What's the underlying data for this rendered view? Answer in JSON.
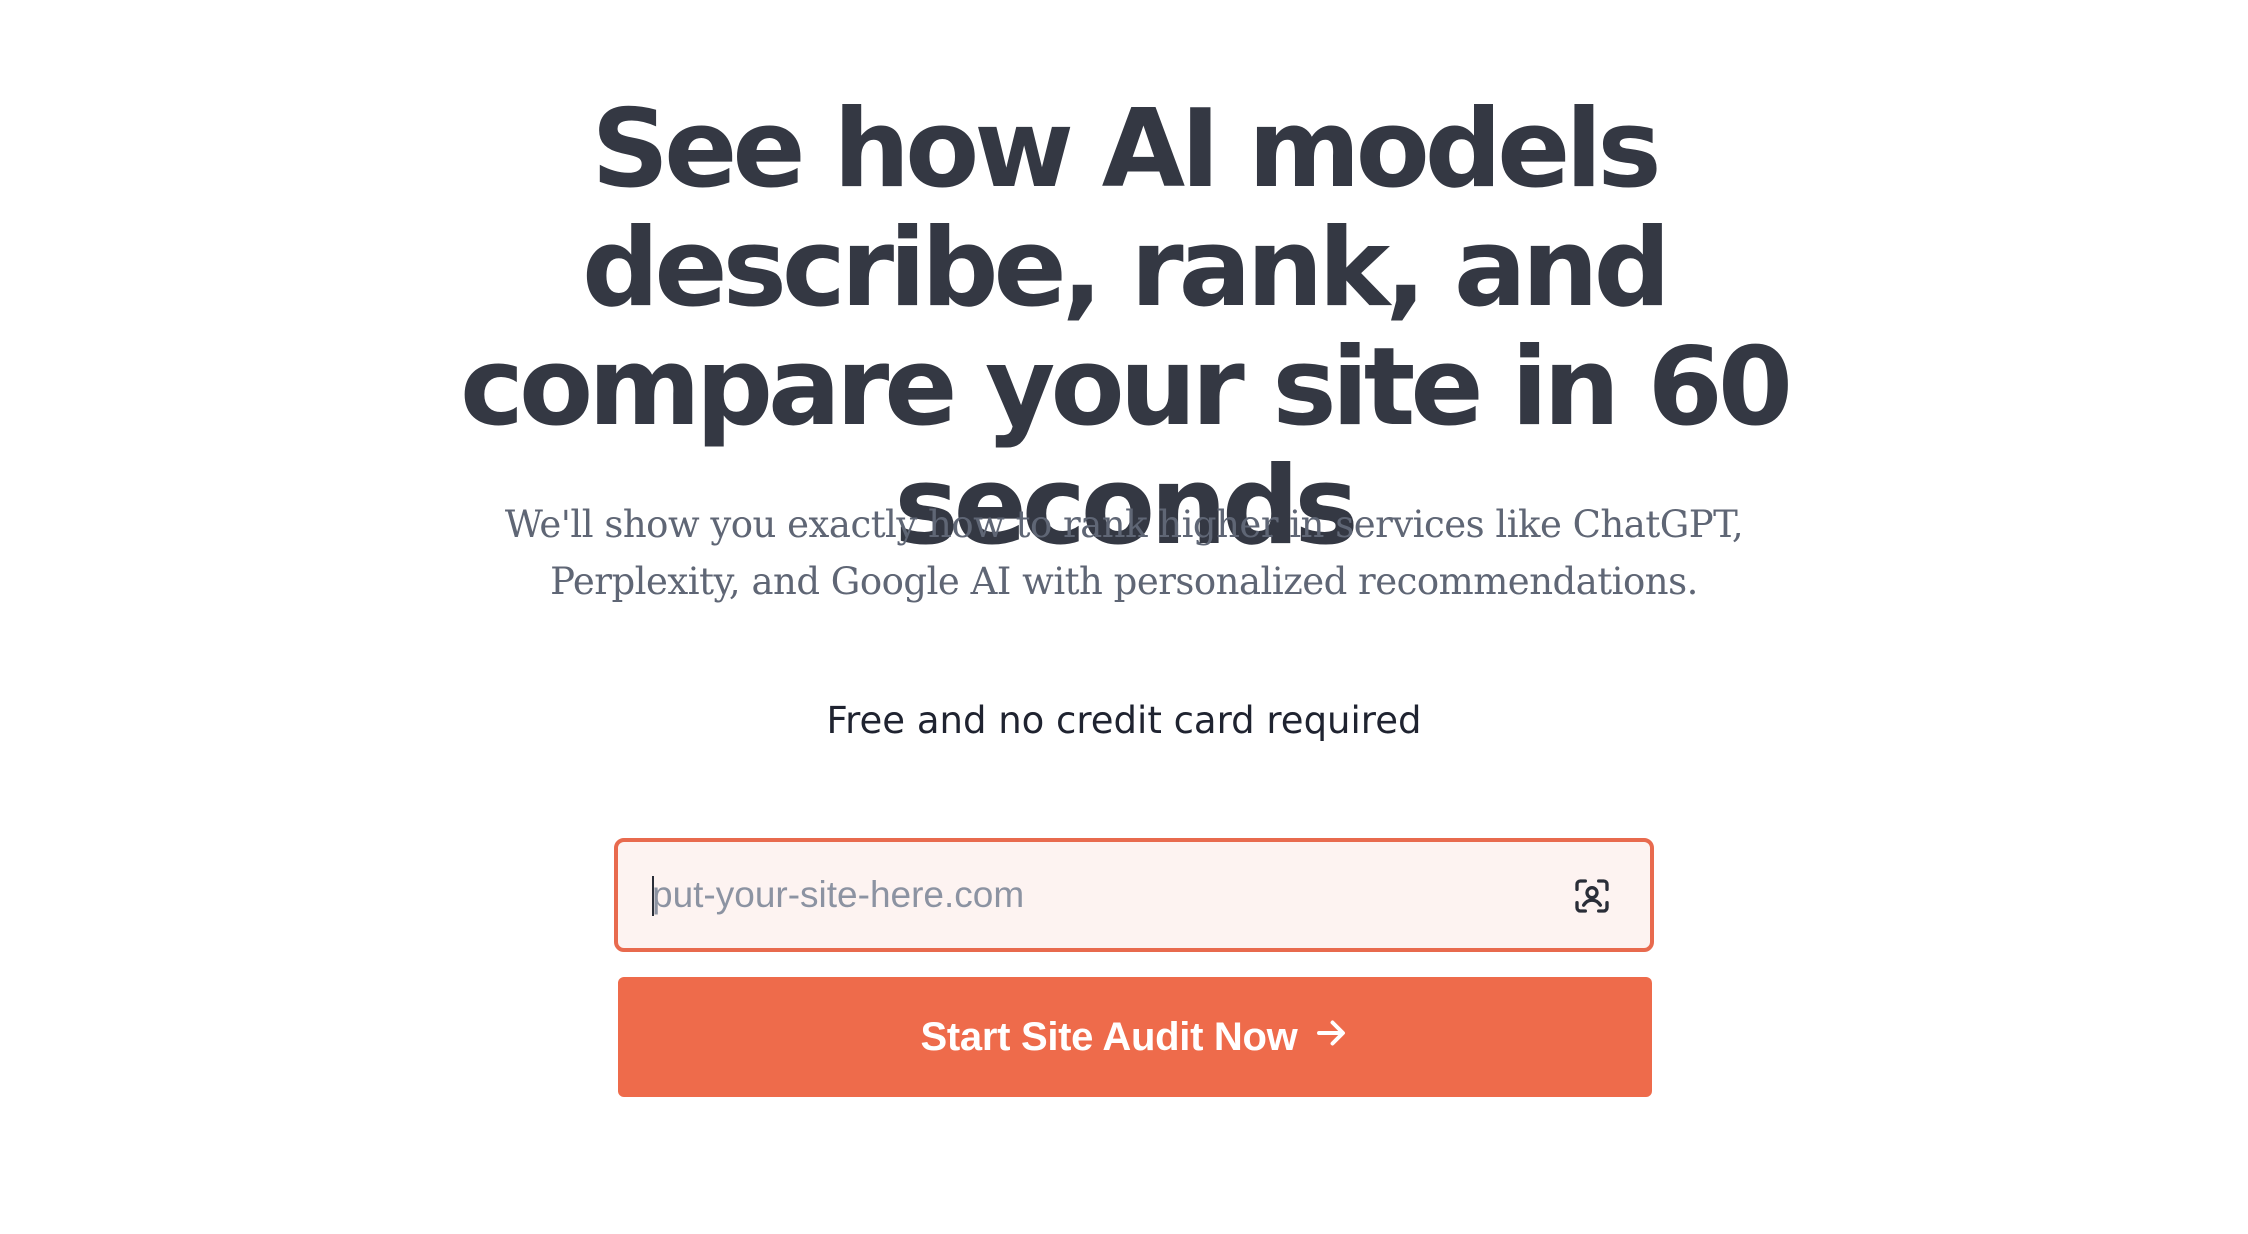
{
  "hero": {
    "headline": "See how AI models describe, rank, and compare your site in 60 seconds",
    "subhead": "We'll show you exactly how to rank higher in services like ChatGPT, Perplexity, and Google AI with personalized recommendations.",
    "note": "Free and no credit card required"
  },
  "form": {
    "input_value": "",
    "input_placeholder": "put-your-site-here.com",
    "input_icon": "face-scan-icon",
    "submit_label": "Start Site Audit Now",
    "submit_icon": "arrow-right-icon"
  },
  "colors": {
    "headline": "#343843",
    "subhead": "#5f6675",
    "accent": "#ee6b4b",
    "input_border": "#e86a4e",
    "input_background": "#fdf3f1",
    "placeholder": "#8c93a2"
  }
}
